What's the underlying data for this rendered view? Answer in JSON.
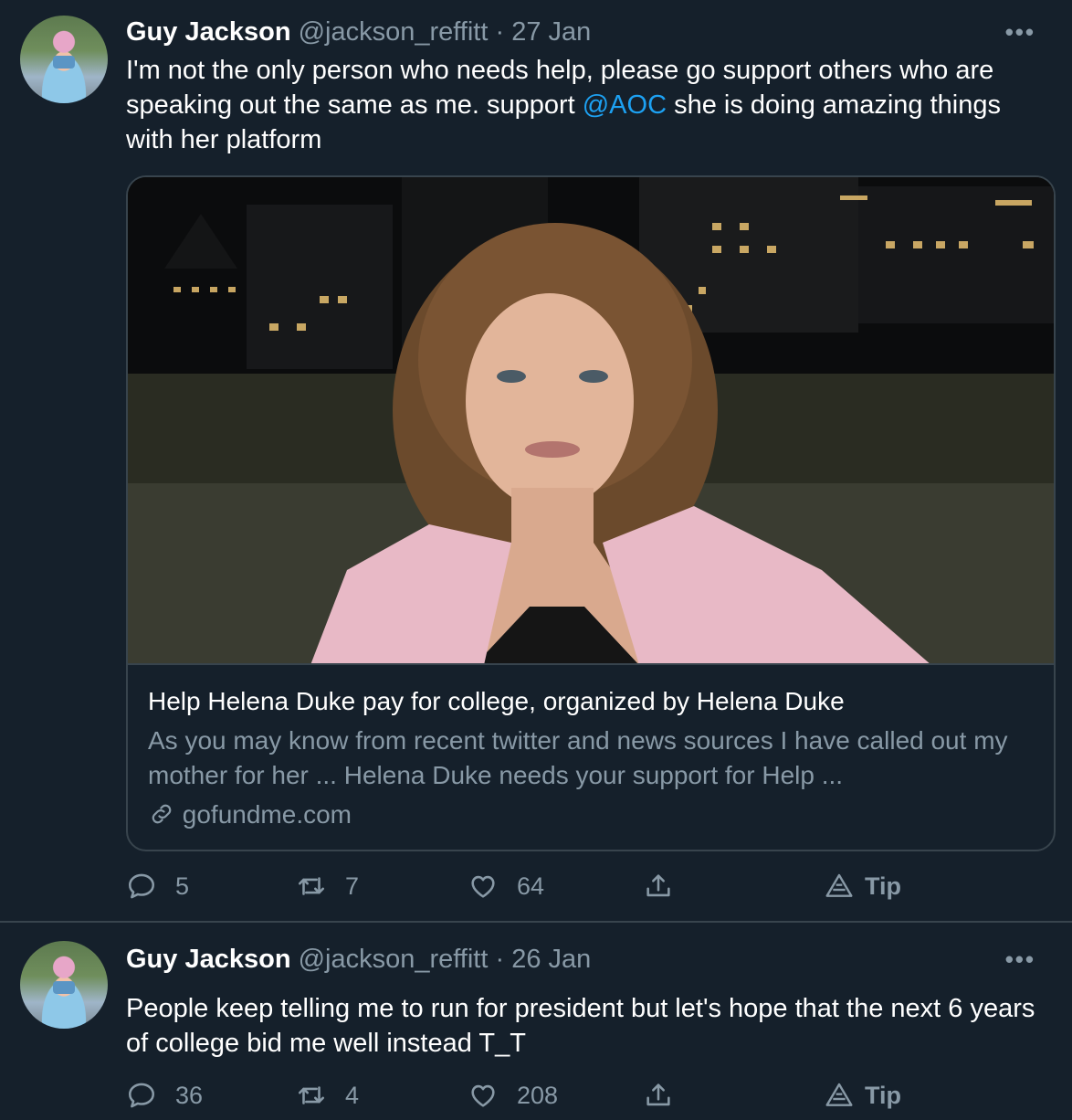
{
  "tweets": [
    {
      "author_name": "Guy Jackson",
      "handle": "@jackson_reffitt",
      "separator": "·",
      "date": "27 Jan",
      "more_label": "•••",
      "text_before_mention": "I'm not the only person who needs help, please go support others who are speaking out the same as me. support ",
      "mention": "@AOC",
      "text_after_mention": " she is doing amazing things with her platform",
      "card": {
        "title": "Help Helena Duke pay for college, organized by Helena Duke",
        "description": "As you may know from recent twitter and news sources I have called out my mother for her ... Helena Duke needs your support for Help ...",
        "domain": "gofundme.com"
      },
      "replies": "5",
      "retweets": "7",
      "likes": "64",
      "tip_label": "Tip"
    },
    {
      "author_name": "Guy Jackson",
      "handle": "@jackson_reffitt",
      "separator": "·",
      "date": "26 Jan",
      "more_label": "•••",
      "text": "People keep telling me to run for president but let's hope that the next 6 years of college bid me well instead T_T",
      "replies": "36",
      "retweets": "4",
      "likes": "208",
      "tip_label": "Tip"
    }
  ],
  "colors": {
    "background": "#15202b",
    "border": "#38444d",
    "secondary_text": "#8899a6",
    "link": "#1da1f2"
  },
  "icons": {
    "reply": "speech-bubble-icon",
    "retweet": "retweet-arrows-icon",
    "like": "heart-icon",
    "share": "share-upload-icon",
    "tip": "tip-triangle-icon",
    "link": "chain-link-icon"
  }
}
